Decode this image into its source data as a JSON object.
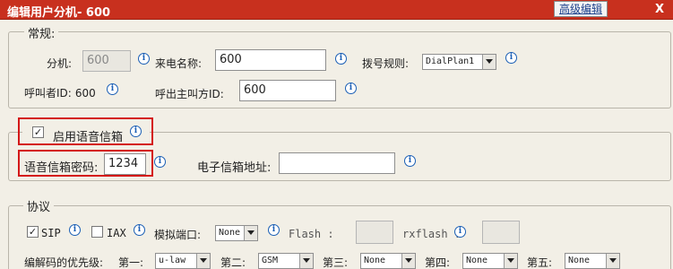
{
  "window": {
    "title": "编辑用户分机- 600",
    "advanced_button": "高级编辑",
    "close_label": "X"
  },
  "general": {
    "legend": "常规:",
    "extension_label": "分机:",
    "extension_value": "600",
    "caller_name_label": "来电名称:",
    "caller_name_value": "600",
    "dial_rule_label": "拨号规则:",
    "dial_rule_value": "DialPlan1",
    "caller_id_label": "呼叫者ID:",
    "caller_id_value": "600",
    "outbound_id_label": "呼出主叫方ID:",
    "outbound_id_value": "600"
  },
  "voicemail": {
    "enable_label": "启用语音信箱",
    "enable_checked": true,
    "password_label": "语音信箱密码:",
    "password_value": "1234",
    "email_label": "电子信箱地址:",
    "email_value": ""
  },
  "protocol": {
    "legend": "协议",
    "sip_label": "SIP",
    "sip_checked": true,
    "iax_label": "IAX",
    "iax_checked": false,
    "analog_port_label": "模拟端口:",
    "analog_port_value": "None",
    "flash_label": "Flash :",
    "rxflash_label": "rxflash :",
    "codec_label": "编解码的优先级:",
    "codecs": [
      {
        "label": "第一:",
        "value": "u-law"
      },
      {
        "label": "第二:",
        "value": "GSM"
      },
      {
        "label": "第三:",
        "value": "None"
      },
      {
        "label": "第四:",
        "value": "None"
      },
      {
        "label": "第五:",
        "value": "None"
      }
    ]
  },
  "colors": {
    "title_bar": "#c8301e",
    "highlight_box": "#d41818",
    "info_icon": "#1b5fb5"
  }
}
